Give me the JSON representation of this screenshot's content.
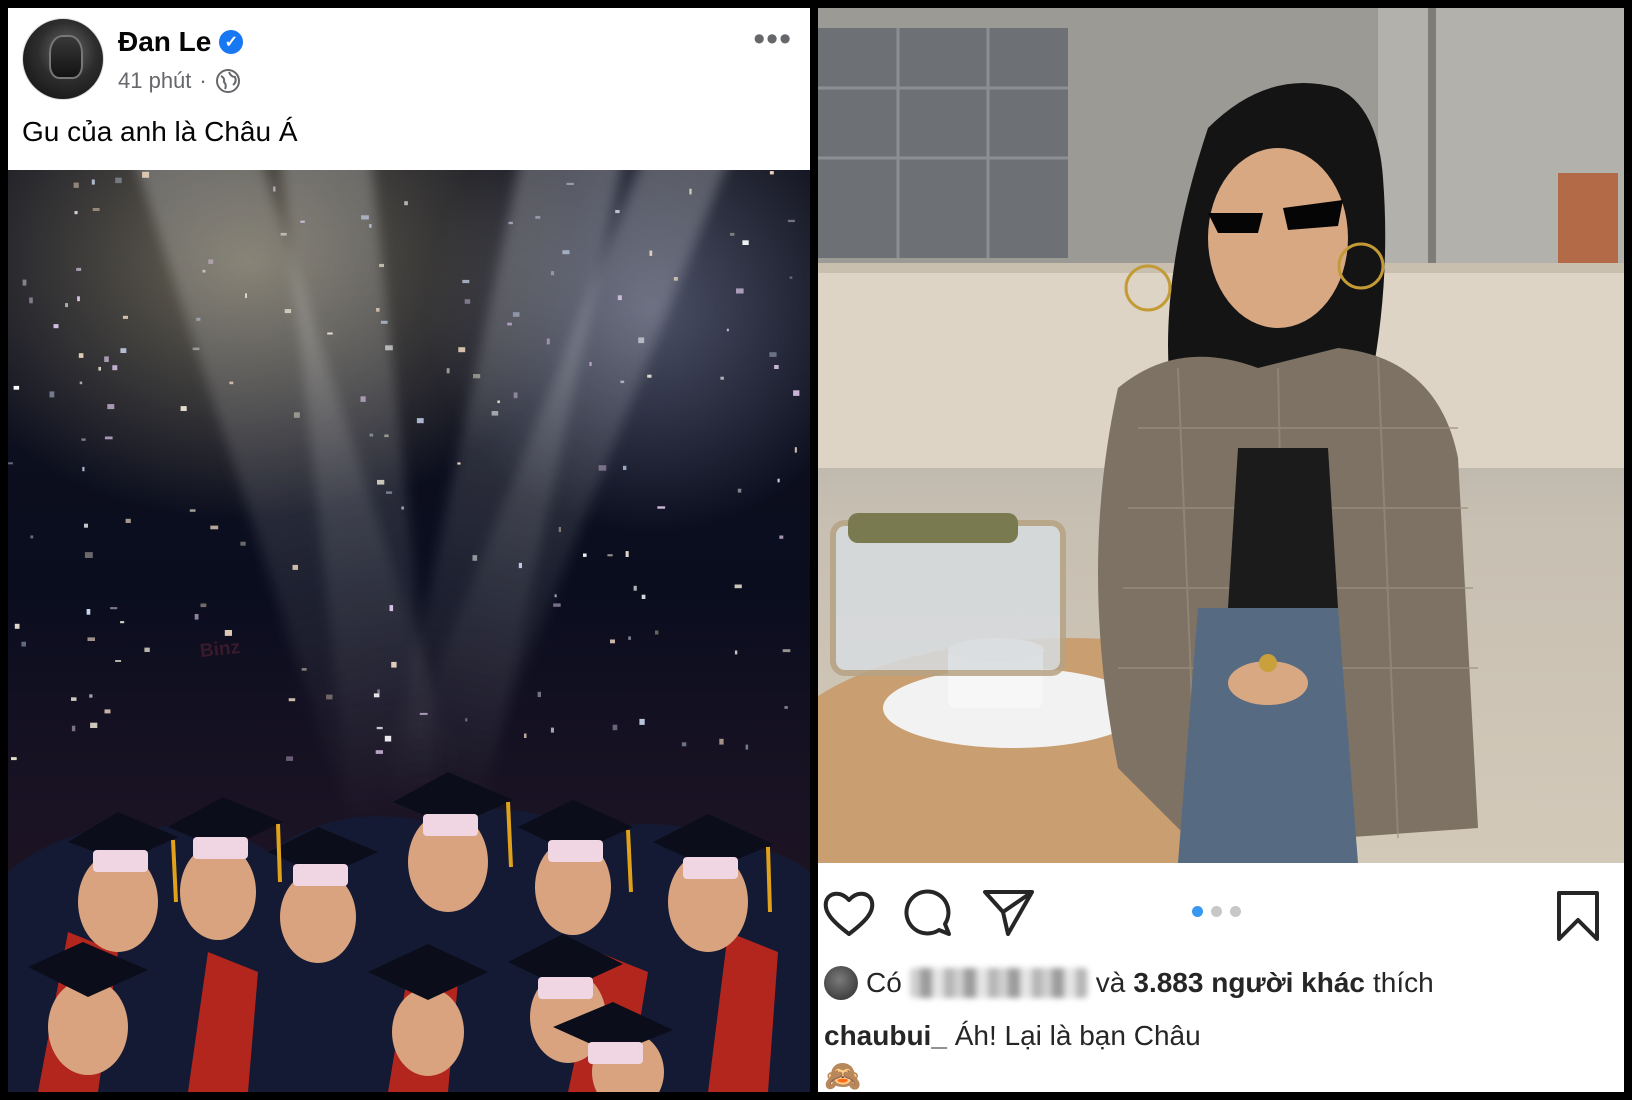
{
  "facebook_post": {
    "author_name": "Đan Le",
    "verified_glyph": "✓",
    "time": "41 phút",
    "separator": "·",
    "privacy_icon": "globe-icon",
    "more_label": "•••",
    "caption": "Gu của anh là Châu Á",
    "photo_cap_text": "Binz",
    "colors": {
      "verified_badge": "#1877f2",
      "text": "#050505",
      "meta": "#65676b"
    }
  },
  "instagram_post": {
    "actions": [
      "heart-icon",
      "comment-icon",
      "share-icon",
      "bookmark-icon"
    ],
    "carousel": {
      "count": 3,
      "active_index": 0
    },
    "likes": {
      "prefix": "Có",
      "conjunction": "và",
      "count_text": "3.883 người khác",
      "suffix": "thích"
    },
    "comment": {
      "username": "chaubui_",
      "text": "Áh! Lại là bạn Châu",
      "emoji": "🙈"
    },
    "colors": {
      "text": "#262626",
      "dot_active": "#3897f0",
      "dot_inactive": "#c7c7c7"
    }
  }
}
